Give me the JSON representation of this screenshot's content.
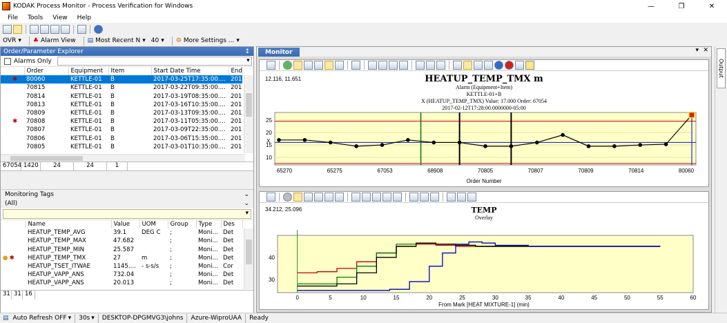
{
  "window": {
    "title": "KODAK Process Monitor - Process Verification for Windows"
  },
  "menu": [
    "File",
    "Tools",
    "View",
    "Help"
  ],
  "toolbar2": {
    "ovr": "OVR",
    "alarm_view": "Alarm View",
    "most_recent": "Most Recent N",
    "count": "40",
    "more_settings": "More Settings ..."
  },
  "order_explorer": {
    "title": "Order/Parameter Explorer",
    "pin": "↕",
    "alarms_only": "Alarms Only",
    "columns": [
      "Order",
      "Equipment",
      "Item",
      "Start Date Time",
      "End"
    ],
    "rows": [
      {
        "alarm": true,
        "order": "80060",
        "equipment": "KETTLE-01",
        "item": "B",
        "start": "2017-03-25T17:35:00....",
        "end": "201"
      },
      {
        "alarm": false,
        "order": "70815",
        "equipment": "KETTLE-01",
        "item": "B",
        "start": "2017-03-22T09:35:00....",
        "end": "201"
      },
      {
        "alarm": false,
        "order": "70814",
        "equipment": "KETTLE-01",
        "item": "B",
        "start": "2017-03-19T08:35:00....",
        "end": "201"
      },
      {
        "alarm": false,
        "order": "70813",
        "equipment": "KETTLE-01",
        "item": "B",
        "start": "2017-03-16T10:35:00....",
        "end": "201"
      },
      {
        "alarm": false,
        "order": "70809",
        "equipment": "KETTLE-01",
        "item": "B",
        "start": "2017-03-13T09:35:00....",
        "end": "201"
      },
      {
        "alarm": true,
        "order": "70808",
        "equipment": "KETTLE-01",
        "item": "B",
        "start": "2017-03-11T05:35:00....",
        "end": "201"
      },
      {
        "alarm": false,
        "order": "70807",
        "equipment": "KETTLE-01",
        "item": "B",
        "start": "2017-03-09T22:35:00....",
        "end": "201"
      },
      {
        "alarm": false,
        "order": "70806",
        "equipment": "KETTLE-01",
        "item": "B",
        "start": "2017-03-06T15:35:00....",
        "end": "201"
      },
      {
        "alarm": false,
        "order": "70805",
        "equipment": "KETTLE-01",
        "item": "B",
        "start": "2017-03-01T10:35:00....",
        "end": "201"
      }
    ],
    "status_cells": [
      "67054",
      "1420",
      "24",
      "24",
      "1"
    ]
  },
  "monitoring_tags": {
    "title": "Monitoring Tags",
    "filter": "(All)",
    "columns": [
      "Name",
      "Value",
      "UOM",
      "Group",
      "Type",
      "Des"
    ],
    "rows": [
      {
        "icons": false,
        "name": "HEATUP_TEMP_AVG",
        "value": "39.1",
        "uom": "DEG C",
        "group": ";",
        "type": "Moni...",
        "des": "Det"
      },
      {
        "icons": false,
        "name": "HEATUP_TEMP_MAX",
        "value": "47.682",
        "uom": "",
        "group": ";",
        "type": "Moni...",
        "des": "Det"
      },
      {
        "icons": false,
        "name": "HEATUP_TEMP_MIN",
        "value": "25.587",
        "uom": "",
        "group": ";",
        "type": "Moni...",
        "des": "Det"
      },
      {
        "icons": true,
        "name": "HEATUP_TEMP_TMX",
        "value": "27",
        "uom": "m",
        "group": ";",
        "type": "Moni...",
        "des": "Det"
      },
      {
        "icons": false,
        "name": "HEATUP_TSET_ITWAE",
        "value": "1145....",
        "uom": "- s-s/s",
        "group": ";",
        "type": "Moni...",
        "des": "Cor"
      },
      {
        "icons": false,
        "name": "HEATUP_VAPP_ANS",
        "value": "732.04",
        "uom": "",
        "group": ";",
        "type": "Moni...",
        "des": "Det"
      },
      {
        "icons": false,
        "name": "HEATUP_VAPP_ANS",
        "value": "20.013",
        "uom": "",
        "group": ";",
        "type": "Moni...",
        "des": "Det"
      }
    ],
    "status_cells": [
      "31",
      "31",
      "16"
    ]
  },
  "monitor": {
    "tab": "Monitor",
    "side_tab": "Output",
    "chart1": {
      "coords": "12.116, 11.651",
      "title": "HEATUP_TEMP_TMX m",
      "sub1": "Alarm (Equipment+Item)",
      "sub2": "KETTLE-01+B",
      "sub3": "X (HEATUP_TEMP_TMX) Value: 17.000  Order: 67054",
      "sub4": "2017-02-12T17:28:00.0000000-05:00",
      "xlabel": "Order Number",
      "ylabel": "X"
    },
    "chart2": {
      "coords": "34.212, 25.096",
      "title": "TEMP",
      "sub1": "Overlay",
      "xlabel": "From Mark [HEAT MIXTURE-1] (min)"
    }
  },
  "statusbar": {
    "auto_refresh": "Auto Refresh OFF",
    "interval": "30s",
    "user": "DESKTOP-DPGMVG3\\johns",
    "db": "Azure-WiproUAA",
    "state": "Ready"
  },
  "chart_data": [
    {
      "type": "line",
      "title": "HEATUP_TEMP_TMX m",
      "xlabel": "Order Number",
      "ylabel": "X",
      "x_tick_labels": [
        "65270",
        "65275",
        "67053",
        "68908",
        "70805",
        "70807",
        "70809",
        "70814",
        "80060"
      ],
      "y_ticks": [
        10,
        15,
        20,
        25
      ],
      "ylim": [
        7,
        28
      ],
      "limits": {
        "ucl": 24.5,
        "lcl": 7.6,
        "center": 16
      },
      "series": [
        {
          "values": [
            17,
            17,
            16,
            14.5,
            15,
            17,
            16,
            16,
            14.5,
            14.5,
            16,
            19,
            14.5,
            14.5,
            15,
            15.3,
            27
          ]
        }
      ],
      "colors": {
        "limit": "#d02020",
        "center": "#2030c0",
        "data": "#000000",
        "plot_bg": "#ffffc8"
      }
    },
    {
      "type": "line",
      "title": "TEMP",
      "xlabel": "From Mark [HEAT MIXTURE-1] (min)",
      "x_ticks": [
        0,
        5,
        10,
        15,
        20,
        25,
        30,
        35,
        40,
        45,
        50,
        55,
        60
      ],
      "y_ticks": [
        30,
        40
      ],
      "xlim": [
        -3,
        60
      ],
      "ylim": [
        24,
        50
      ],
      "series": [
        {
          "color": "#c00000",
          "x": [
            0,
            3,
            6,
            9,
            12,
            15,
            18,
            21,
            24,
            27,
            30,
            35,
            40,
            45,
            50,
            55
          ],
          "values": [
            33,
            33.5,
            35,
            38,
            42,
            45,
            46,
            45.5,
            45,
            45,
            45,
            45,
            45,
            45,
            45,
            45
          ]
        },
        {
          "color": "#008000",
          "x": [
            0,
            3,
            6,
            9,
            12,
            15,
            18,
            21,
            24,
            27,
            30,
            35,
            40,
            45,
            50,
            55
          ],
          "values": [
            28,
            28,
            31,
            36,
            42,
            46,
            46.5,
            46,
            45.5,
            45,
            45,
            45,
            45,
            45,
            45,
            45
          ]
        },
        {
          "color": "#000000",
          "x": [
            0,
            3,
            6,
            9,
            12,
            15,
            18,
            21,
            24,
            27,
            30,
            35,
            40,
            45,
            50,
            55
          ],
          "values": [
            27,
            27,
            28,
            33,
            40,
            45,
            46.5,
            46,
            45.5,
            45,
            45,
            45,
            45,
            45,
            45,
            45
          ]
        },
        {
          "color": "#0000c0",
          "x": [
            0,
            10,
            14,
            17,
            20,
            22,
            24,
            26,
            28,
            30,
            35,
            40,
            45,
            50,
            55
          ],
          "values": [
            25,
            25,
            25.5,
            29,
            36,
            42,
            46,
            47,
            46.5,
            45.5,
            45,
            45,
            45,
            45,
            45
          ]
        }
      ],
      "colors": {
        "plot_bg": "#ffffc8"
      }
    }
  ]
}
